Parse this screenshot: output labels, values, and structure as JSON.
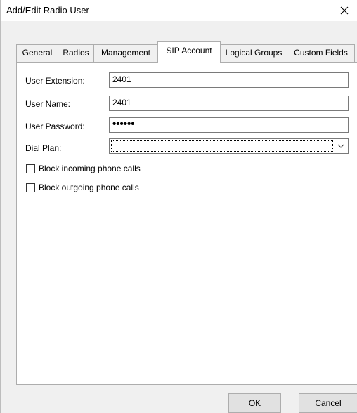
{
  "window": {
    "title": "Add/Edit Radio User"
  },
  "tabs": [
    {
      "label": "General"
    },
    {
      "label": "Radios"
    },
    {
      "label": "Management"
    },
    {
      "label": "SIP Account"
    },
    {
      "label": "Logical Groups"
    },
    {
      "label": "Custom Fields"
    }
  ],
  "active_tab": "SIP Account",
  "form": {
    "extension_label": "User Extension:",
    "extension_value": "2401",
    "name_label": "User Name:",
    "name_value": "2401",
    "password_label": "User Password:",
    "password_value": "••••••",
    "dialplan_label": "Dial Plan:",
    "dialplan_value": ""
  },
  "checkboxes": {
    "block_incoming": "Block incoming phone calls",
    "block_outgoing": "Block outgoing phone calls"
  },
  "buttons": {
    "ok": "OK",
    "cancel": "Cancel"
  },
  "icons": {
    "close": "close-icon",
    "dropdown": "chevron-down-icon"
  },
  "colors": {
    "panel_bg": "#ffffff",
    "window_bg": "#f0f0f0",
    "border": "#adadad"
  }
}
